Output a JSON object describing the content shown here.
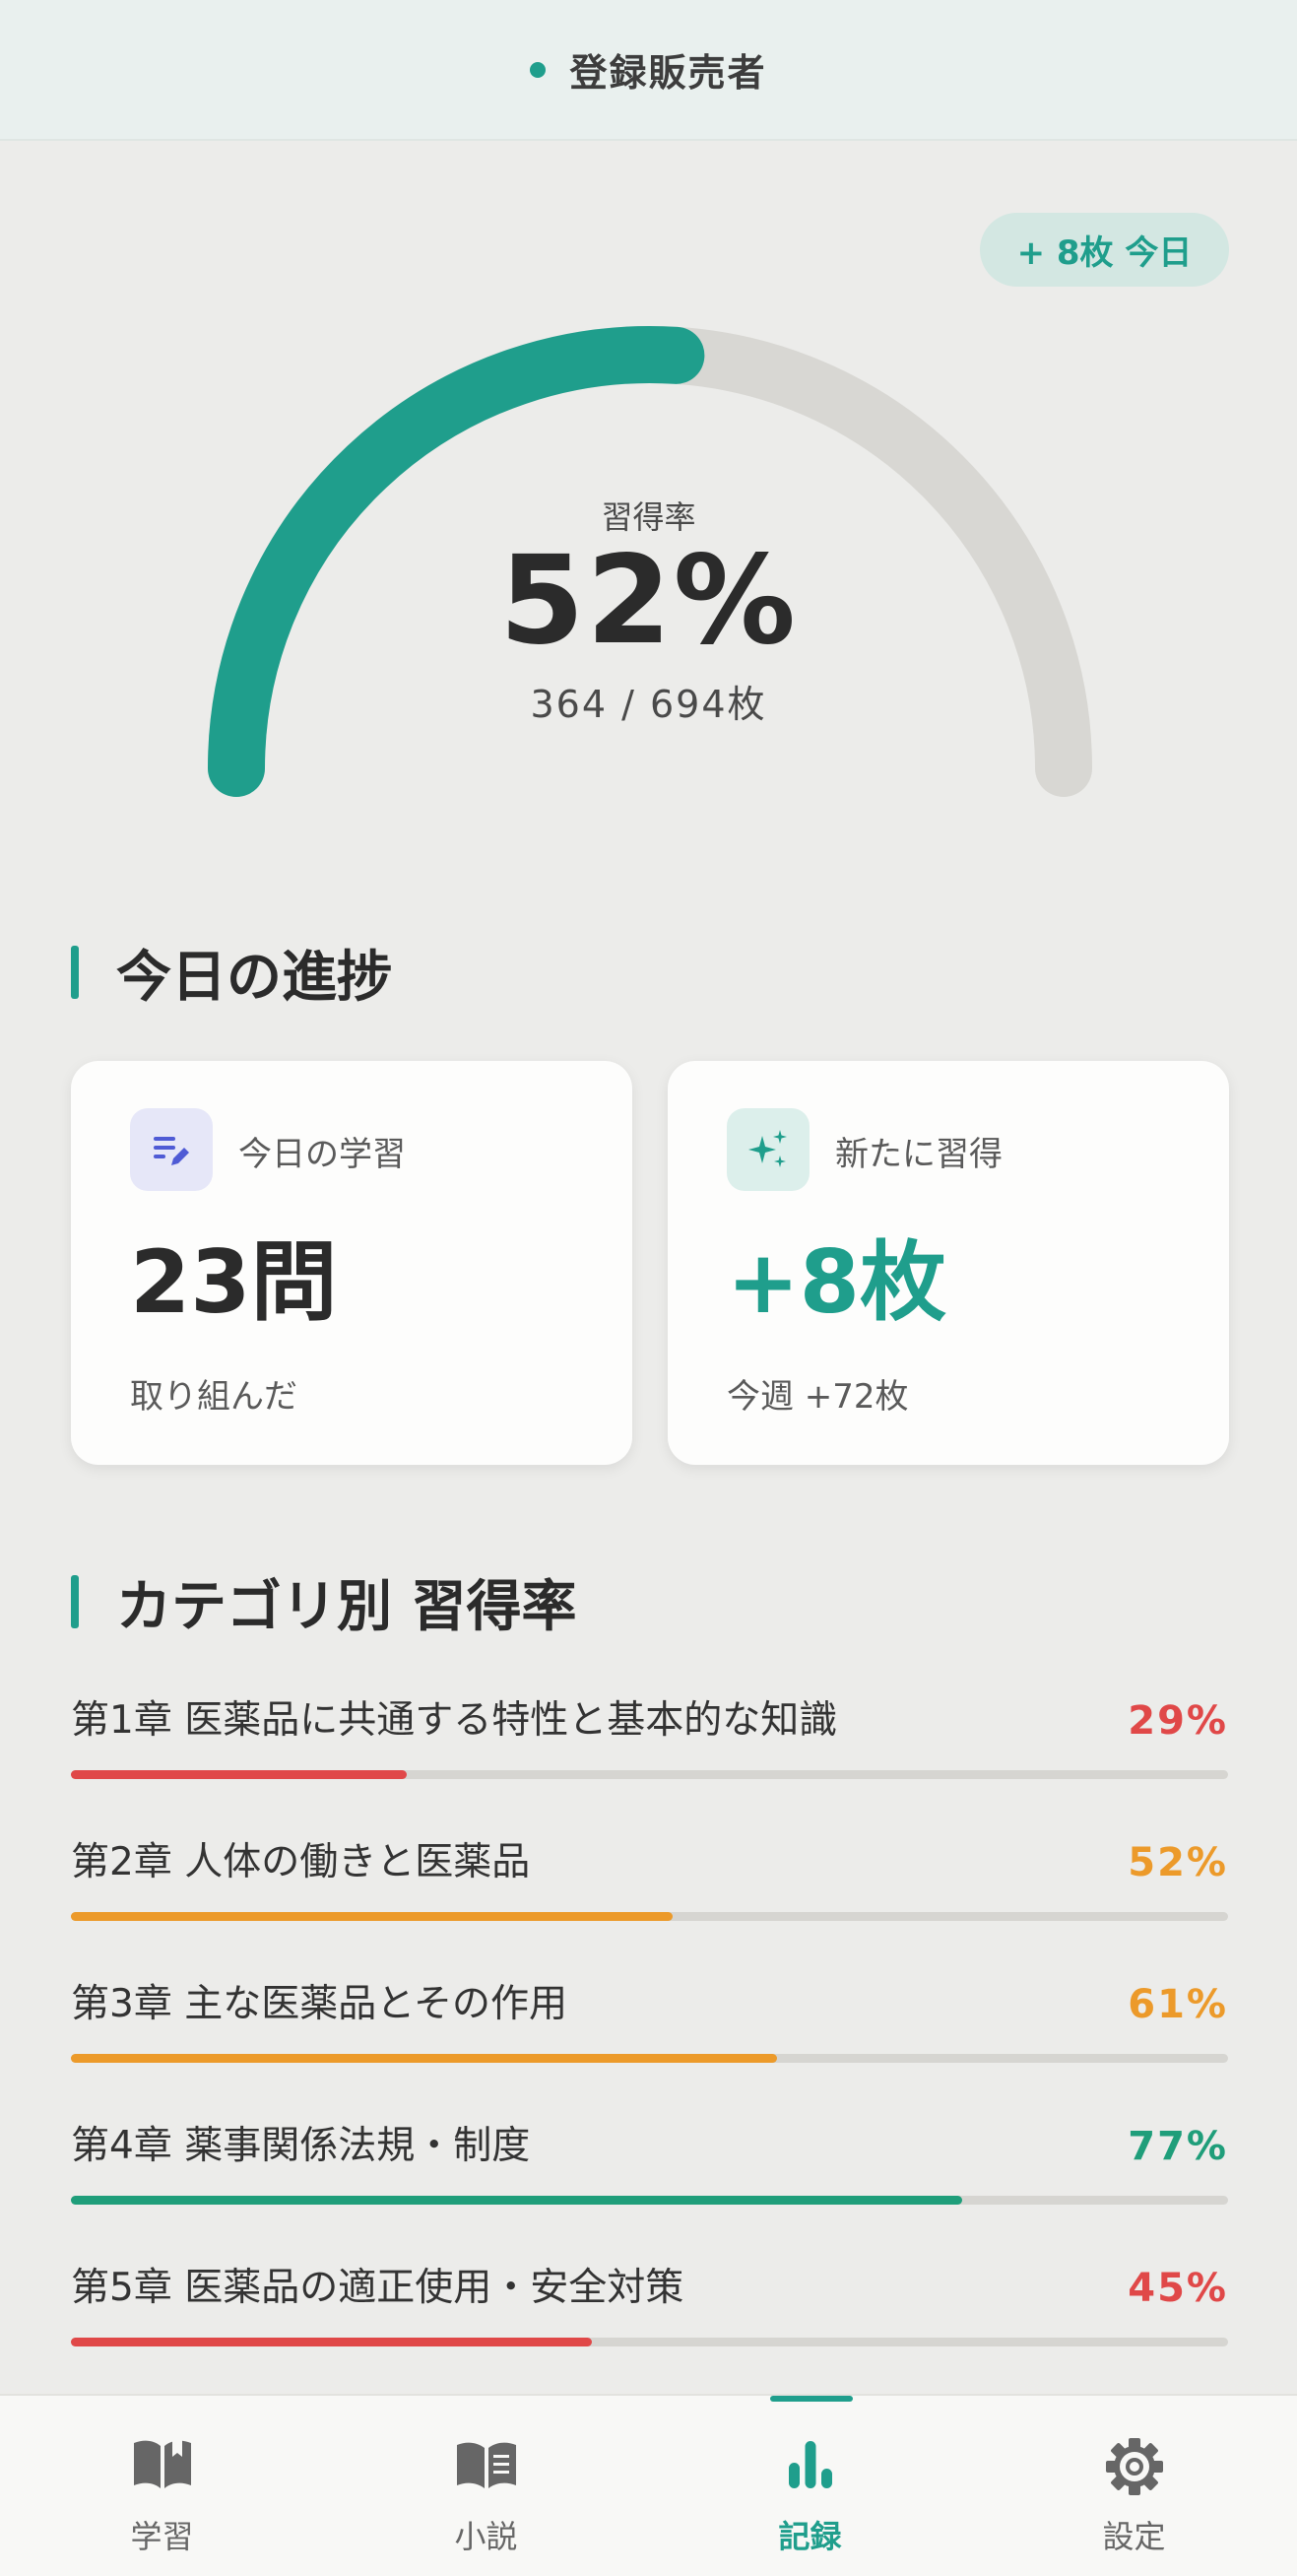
{
  "header": {
    "title": "登録販売者"
  },
  "today_badge": "+ 8枚 今日",
  "mastery": {
    "caption": "習得率",
    "percent_label": "52%",
    "fraction": 0.52,
    "count_label": "364 / 694枚",
    "accent_color": "#1f9e8c",
    "track_color": "#d8d7d3"
  },
  "today_section": {
    "title": "今日の進捗"
  },
  "cards": [
    {
      "icon": "edit-list-icon",
      "label": "今日の学習",
      "value": "23問",
      "sub": "取り組んだ"
    },
    {
      "icon": "sparkle-icon",
      "label": "新たに習得",
      "value": "+8枚",
      "sub": "今週 +72枚"
    }
  ],
  "category_section": {
    "title": "カテゴリ別 習得率"
  },
  "categories": [
    {
      "name": "第1章 医薬品に共通する特性と基本的な知識",
      "percent_label": "29%",
      "fraction": 0.29,
      "color": "#e04848"
    },
    {
      "name": "第2章 人体の働きと医薬品",
      "percent_label": "52%",
      "fraction": 0.52,
      "color": "#ec9a2a"
    },
    {
      "name": "第3章 主な医薬品とその作用",
      "percent_label": "61%",
      "fraction": 0.61,
      "color": "#ec9a2a"
    },
    {
      "name": "第4章 薬事関係法規・制度",
      "percent_label": "77%",
      "fraction": 0.77,
      "color": "#1f9e7a"
    },
    {
      "name": "第5章 医薬品の適正使用・安全対策",
      "percent_label": "45%",
      "fraction": 0.45,
      "color": "#e04848"
    }
  ],
  "tabs": [
    {
      "label": "学習",
      "icon": "open-book-icon"
    },
    {
      "label": "小説",
      "icon": "novel-book-icon"
    },
    {
      "label": "記録",
      "icon": "bar-chart-icon",
      "active": true
    },
    {
      "label": "設定",
      "icon": "gear-icon"
    }
  ]
}
